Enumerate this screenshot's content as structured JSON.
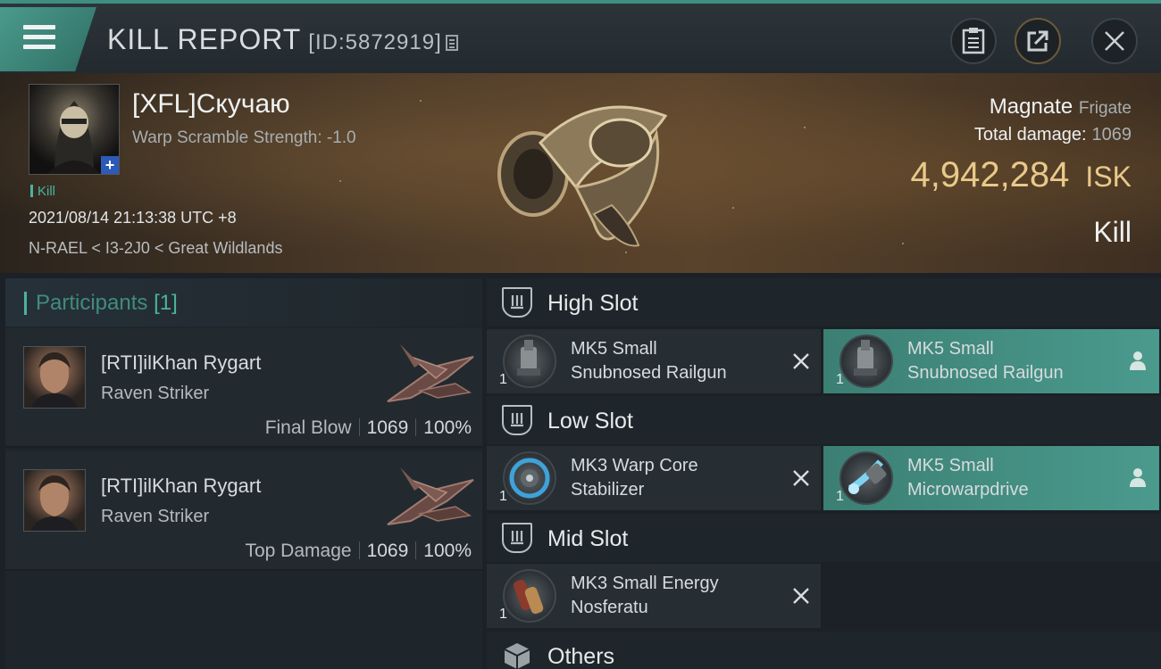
{
  "header": {
    "title": "KILL REPORT",
    "report_id": "[ID:5872919]"
  },
  "victim": {
    "name": "[XFL]Скучаю",
    "warp_scramble": "Warp Scramble Strength: -1.0",
    "tag": "Kill",
    "datetime": "2021/08/14 21:13:38 UTC +8",
    "location": "N-RAEL < I3-2J0 < Great Wildlands",
    "ship_name": "Magnate",
    "ship_class": "Frigate",
    "total_damage_label": "Total damage:",
    "total_damage": "1069",
    "isk_value": "4,942,284",
    "isk_unit": "ISK",
    "result": "Kill"
  },
  "participants": {
    "label": "Participants",
    "count": "[1]",
    "cards": [
      {
        "name": "[RTI]ilKhan Rygart",
        "ship": "Raven Striker",
        "role": "Final Blow",
        "damage": "1069",
        "percent": "100%"
      },
      {
        "name": "[RTI]ilKhan Rygart",
        "ship": "Raven Striker",
        "role": "Top Damage",
        "damage": "1069",
        "percent": "100%"
      }
    ]
  },
  "fitting": {
    "high_slot": {
      "title": "High Slot",
      "modules": [
        {
          "qty": "1",
          "line1": "MK5 Small",
          "line2": "Snubnosed Railgun",
          "state": "destroyed"
        },
        {
          "qty": "1",
          "line1": "MK5 Small",
          "line2": "Snubnosed Railgun",
          "state": "dropped"
        }
      ]
    },
    "low_slot": {
      "title": "Low Slot",
      "modules": [
        {
          "qty": "1",
          "line1": "MK3 Warp Core",
          "line2": "Stabilizer",
          "state": "destroyed"
        },
        {
          "qty": "1",
          "line1": "MK5 Small",
          "line2": "Microwarpdrive",
          "state": "dropped"
        }
      ]
    },
    "mid_slot": {
      "title": "Mid Slot",
      "modules": [
        {
          "qty": "1",
          "line1": "MK3 Small Energy",
          "line2": "Nosferatu",
          "state": "destroyed"
        }
      ]
    },
    "others": {
      "title": "Others"
    }
  },
  "colors": {
    "accent_teal": "#4bb39e",
    "isk_gold": "#e8c98a",
    "dropped_bg": "#4a9a8d"
  }
}
